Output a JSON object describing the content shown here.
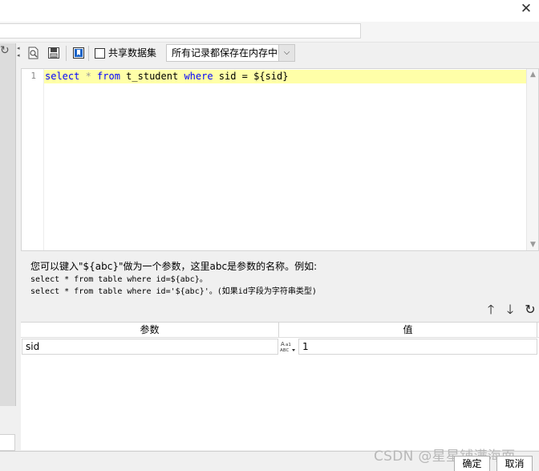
{
  "window": {
    "close_glyph": "✕"
  },
  "toolbar": {
    "icons": [
      "preview-icon",
      "save-icon",
      "bookmark-icon"
    ],
    "share_label": "共享数据集",
    "share_checked": false,
    "record_mode": "所有记录都保存在内存中"
  },
  "editor": {
    "line_number": "1",
    "tokens": [
      {
        "text": "select",
        "type": "keyword"
      },
      {
        "text": " * ",
        "type": "operator"
      },
      {
        "text": "from",
        "type": "keyword"
      },
      {
        "text": " t_student ",
        "type": "plain"
      },
      {
        "text": "where",
        "type": "keyword"
      },
      {
        "text": " sid = ${sid}",
        "type": "plain"
      }
    ]
  },
  "hint": {
    "line1": "您可以键入\"${abc}\"做为一个参数，这里abc是参数的名称。例如:",
    "line2": "select * from table where id=${abc}。",
    "line3": "select * from table where id='${abc}'。(如果id字段为字符串类型)"
  },
  "params": {
    "columns": [
      "参数",
      "值"
    ],
    "rows": [
      {
        "name": "sid",
        "type_icon": "string-type-icon",
        "value": "1"
      }
    ]
  },
  "footer": {
    "watermark": "CSDN @星星铺满海面",
    "ok_label": "确定",
    "cancel_label": "取消"
  },
  "colors": {
    "keyword": "#0000ff",
    "operator": "#9a9a9a",
    "current_line": "#ffffa8",
    "accent_blue": "#1b64c8"
  }
}
